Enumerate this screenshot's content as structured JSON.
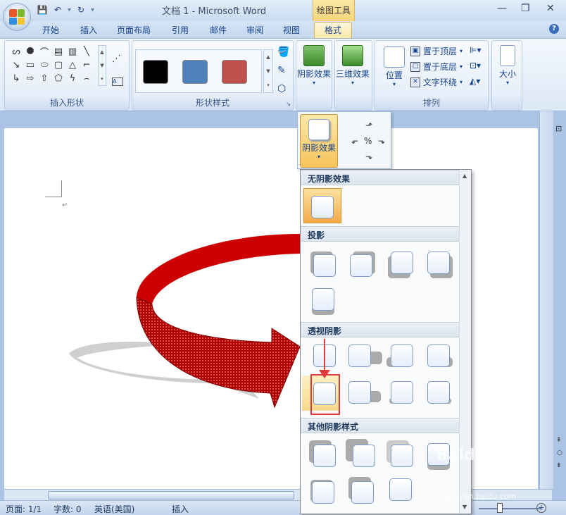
{
  "title": "文档 1 - Microsoft Word",
  "context_tab": "绘图工具",
  "tabs": [
    "开始",
    "插入",
    "页面布局",
    "引用",
    "邮件",
    "审阅",
    "视图",
    "格式"
  ],
  "ribbon": {
    "insert_shapes_label": "插入形状",
    "shape_styles_label": "形状样式",
    "shadow_effects": "阴影效果",
    "effects_3d": "三维效果",
    "position": "位置",
    "bring_to_front": "置于顶层",
    "send_to_back": "置于底层",
    "text_wrapping": "文字环绕",
    "arrange_label": "排列",
    "size": "大小",
    "swatch_colors": [
      "#000000",
      "#4f81bd",
      "#c0504d"
    ]
  },
  "popout": {
    "shadow_effects": "阴影效果"
  },
  "panel": {
    "sections": [
      "无阴影效果",
      "投影",
      "透视阴影",
      "其他阴影样式"
    ]
  },
  "statusbar": {
    "page": "页面: 1/1",
    "words": "字数: 0",
    "language": "英语(美国)",
    "mode": "插入"
  },
  "watermark": {
    "text": "Baidu 经验",
    "sub": "jingyan.baidu.com"
  }
}
